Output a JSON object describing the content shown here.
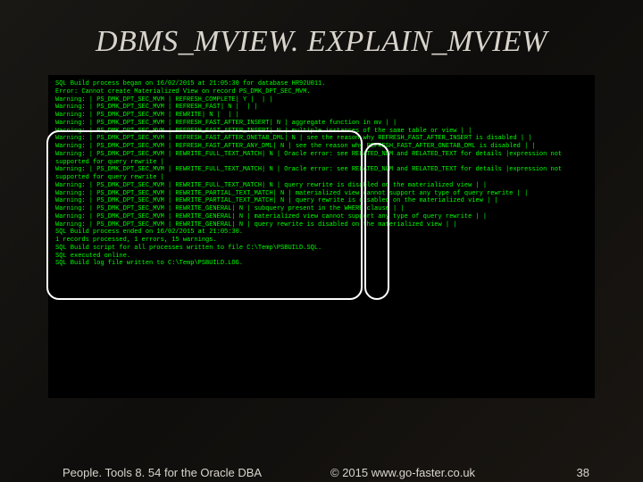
{
  "title": "DBMS_MVIEW. EXPLAIN_MVIEW",
  "terminal": {
    "lines": [
      "SQL Build process began on 16/02/2015 at 21:05:30 for database HR92U011.",
      "Error: Cannot create Materialized View on record PS_DMK_DPT_SEC_MVM.",
      "Warning: | PS_DMK_DPT_SEC_MVM | REFRESH_COMPLETE| Y |  | |",
      "Warning: | PS_DMK_DPT_SEC_MVM | REFRESH_FAST| N |  | |",
      "Warning: | PS_DMK_DPT_SEC_MVM | REWRITE| N |  | |",
      "Warning: | PS_DMK_DPT_SEC_MVM | REFRESH_FAST_AFTER_INSERT| N | aggregate function in mv | |",
      "Warning: | PS_DMK_DPT_SEC_MVM | REFRESH_FAST_AFTER_INSERT| N | multiple instances of the same table or view | |",
      "Warning: | PS_DMK_DPT_SEC_MVM | REFRESH_FAST_AFTER_ONETAB_DML| N | see the reason why REFRESH_FAST_AFTER_INSERT is disabled | |",
      "Warning: | PS_DMK_DPT_SEC_MVM | REFRESH_FAST_AFTER_ANY_DML| N | see the reason why REFRESH_FAST_AFTER_ONETAB_DML is disabled | |",
      "Warning: | PS_DMK_DPT_SEC_MVM | REWRITE_FULL_TEXT_MATCH| N | Oracle error: see RELATED_NUM and RELATED_TEXT for details |expression not supported for query rewrite |",
      "Warning: | PS_DMK_DPT_SEC_MVM | REWRITE_FULL_TEXT_MATCH| N | Oracle error: see RELATED_NUM and RELATED_TEXT for details |expression not supported for query rewrite |",
      "Warning: | PS_DMK_DPT_SEC_MVM | REWRITE_FULL_TEXT_MATCH| N | query rewrite is disabled on the materialized view | |",
      "Warning: | PS_DMK_DPT_SEC_MVM | REWRITE_PARTIAL_TEXT_MATCH| N | materialized view cannot support any type of query rewrite | |",
      "Warning: | PS_DMK_DPT_SEC_MVM | REWRITE_PARTIAL_TEXT_MATCH| N | query rewrite is disabled on the materialized view | |",
      "Warning: | PS_DMK_DPT_SEC_MVM | REWRITE_GENERAL| N | subquery present in the WHERE clause | |",
      "Warning: | PS_DMK_DPT_SEC_MVM | REWRITE_GENERAL| N | materialized view cannot support any type of query rewrite | |",
      "Warning: | PS_DMK_DPT_SEC_MVM | REWRITE_GENERAL| N | query rewrite is disabled on the materialized view | |",
      "",
      "SQL Build process ended on 16/02/2015 at 21:05:30.",
      "1 records processed, 1 errors, 15 warnings.",
      "SQL Build script for all processes written to file C:\\Temp\\PSBUILD.SQL.",
      "SQL executed online.",
      "SQL Build log file written to C:\\Temp\\PSBUILD.LOG."
    ]
  },
  "footer": {
    "left": "People. Tools 8. 54 for the Oracle DBA",
    "center": "© 2015 www.go-faster.co.uk",
    "right": "38"
  }
}
